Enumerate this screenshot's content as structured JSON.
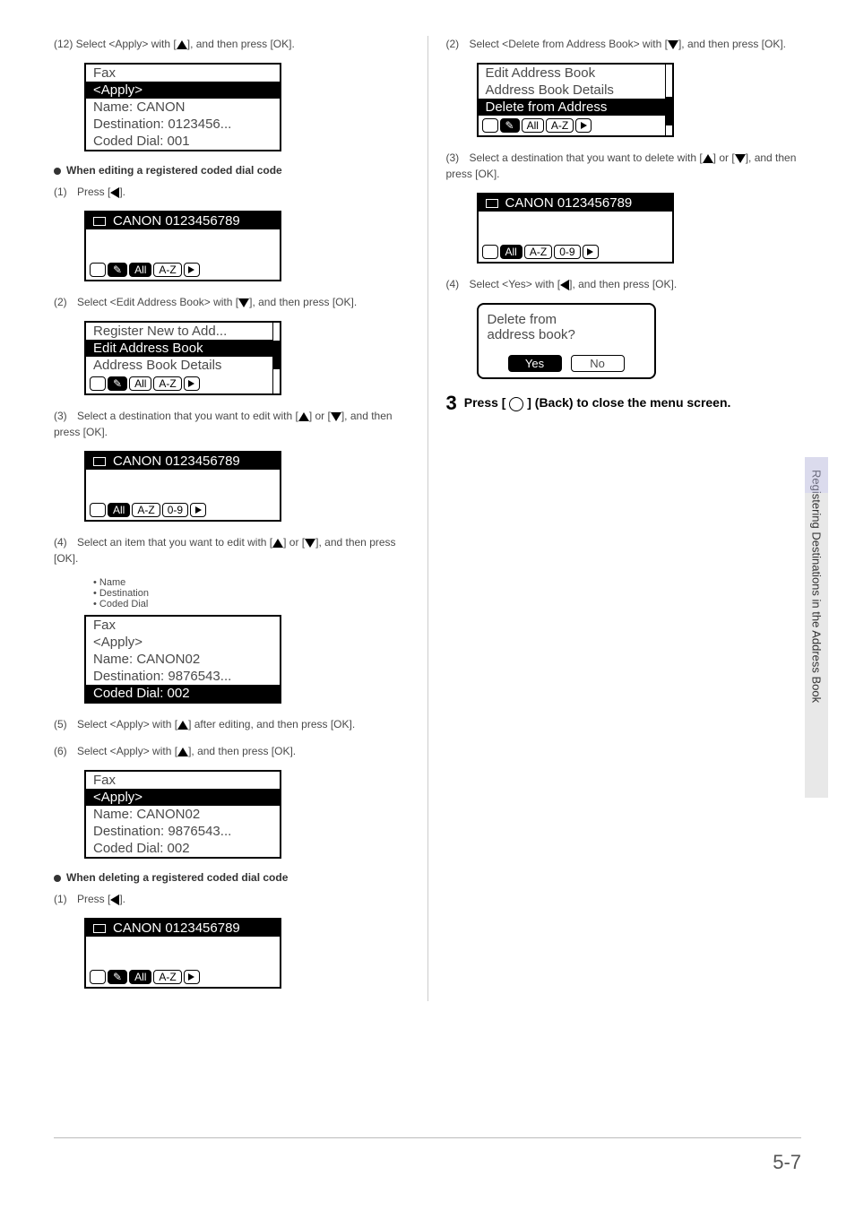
{
  "leftcol": {
    "step12": "(12)  Select <Apply> with [",
    "step12_after": "], and then press [OK].",
    "lcd1": {
      "l1": "Fax",
      "l2": "<Apply>",
      "l3": "Name: CANON",
      "l4": "Destination: 0123456...",
      "l5": "Coded Dial: 001"
    },
    "heading_edit": "When editing a registered coded dial code",
    "s1": "(1)",
    "s1t": "Press [",
    "s1t2": "].",
    "lcd2_title": "CANON 0123456789",
    "btn_all": "All",
    "btn_az": "A-Z",
    "btn_09": "0-9",
    "s2": "(2)",
    "s2t": "Select <Edit Address Book> with [",
    "s2t2": "], and then press [OK].",
    "lcd3": {
      "l1": "Register New to Add...",
      "l2": "Edit Address Book",
      "l3": "Address Book Details"
    },
    "s3": "(3)",
    "s3t": "Select a destination that you want to edit with [",
    "s3t2": "] or [",
    "s3t3": "], and then press [OK].",
    "lcd4_title": "CANON 0123456789",
    "s4": "(4)",
    "s4t": "Select an item that you want to edit with [",
    "s4t2": "] or [",
    "s4t3": "], and then press [OK].",
    "bullets": [
      "Name",
      "Destination",
      "Coded Dial"
    ],
    "lcd5": {
      "l1": "Fax",
      "l2": "<Apply>",
      "l3": "Name: CANON02",
      "l4": "Destination: 9876543...",
      "l5": "Coded Dial: 002"
    },
    "s5": "(5)",
    "s5t": "Select <Apply> with [",
    "s5t2": "] after editing, and then press [OK].",
    "s6": "(6)",
    "s6t": "Select <Apply> with [",
    "s6t2": "], and then press [OK].",
    "lcd6": {
      "l1": "Fax",
      "l2": "<Apply>",
      "l3": "Name: CANON02",
      "l4": "Destination: 9876543...",
      "l5": "Coded Dial: 002"
    },
    "heading_del": "When deleting a registered coded dial code",
    "d1": "(1)",
    "d1t": "Press [",
    "d1t2": "].",
    "lcd7_title": "CANON 0123456789"
  },
  "rightcol": {
    "s2": "(2)",
    "s2t": "Select <Delete from Address Book> with [",
    "s2t2": "], and then press [OK].",
    "lcd1": {
      "l1": "Edit Address Book",
      "l2": "Address Book Details",
      "l3": "Delete from Address"
    },
    "s3": "(3)",
    "s3t": "Select a destination that you want to delete with [",
    "s3t2": "] or [",
    "s3t3": "], and then press [OK].",
    "lcd2_title": "CANON 0123456789",
    "s4": "(4)",
    "s4t": "Select <Yes> with [",
    "s4t2": "], and then press [OK].",
    "dialog": {
      "l1": "Delete from",
      "l2": "address book?",
      "yes": "Yes",
      "no": "No"
    },
    "bigstep_num": "3",
    "bigstep_a": "Press [",
    "bigstep_b": "] (Back) to close the menu screen."
  },
  "sidetab": "Registering Destinations in the Address Book",
  "pagenum": "5-7",
  "btn_all": "All",
  "btn_az": "A-Z",
  "btn_09": "0-9"
}
